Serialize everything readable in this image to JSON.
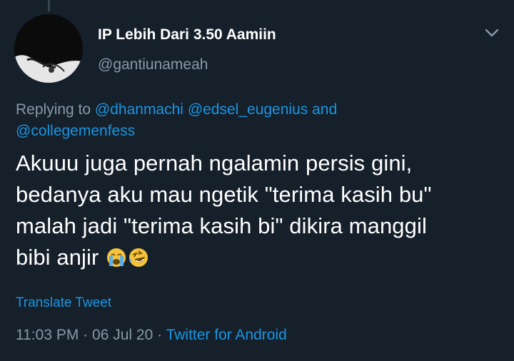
{
  "user": {
    "display_name": "IP Lebih Dari 3.50 Aamiin",
    "handle": "@gantiunameah"
  },
  "reply": {
    "prefix": "Replying to",
    "mentions": [
      "@dhanmachi",
      "@edsel_eugenius",
      "@collegemenfess"
    ],
    "conjunction": "and"
  },
  "tweet": {
    "lines": [
      "Akuuu juga pernah ngalamin persis gini,",
      "bedanya aku mau ngetik \"terima kasih bu\"",
      "malah jadi \"terima kasih bi\" dikira manggil",
      "bibi anjir"
    ],
    "emojis": [
      "loudly-crying-face-icon",
      "rolling-on-floor-laughing-icon"
    ]
  },
  "translate_label": "Translate Tweet",
  "meta": {
    "time": "11:03 PM",
    "separator": "·",
    "date": "06 Jul 20",
    "source": "Twitter for Android"
  },
  "colors": {
    "background": "#15202b",
    "accent": "#1b95e0",
    "secondary_text": "#8899a6"
  }
}
